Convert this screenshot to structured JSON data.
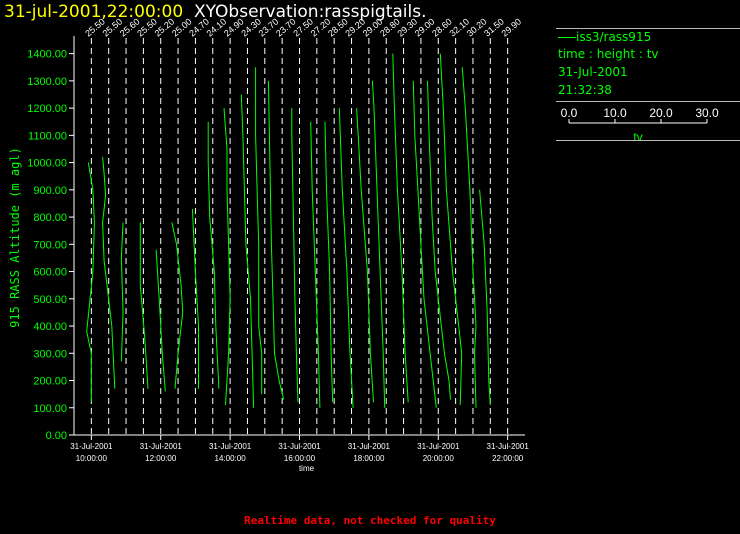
{
  "header": {
    "datetime": "31-jul-2001,22:00:00",
    "name": "XYObservation:rasspigtails."
  },
  "legend": {
    "series": "iss3/rass915",
    "line2": "time : height : tv",
    "date": "31-Jul-2001",
    "time": "21:32:38",
    "scale_ticks": [
      "0.0",
      "10.0",
      "20.0",
      "30.0"
    ],
    "scale_label": "tv"
  },
  "footer": "Realtime data, not checked for quality",
  "colors": {
    "background": "#000000",
    "trace": "#00ff00",
    "axis": "#ffffff",
    "datetime": "#ffff00",
    "footer": "#ff0000"
  },
  "chart_data": {
    "type": "line",
    "ylabel": "915 RASS Altitude (m agl)",
    "xlabel": "time",
    "ylim": [
      0,
      1450
    ],
    "yticks": [
      "0.00",
      "100.00",
      "200.00",
      "300.00",
      "400.00",
      "500.00",
      "600.00",
      "700.00",
      "800.00",
      "900.00",
      "1000.00",
      "1100.00",
      "1200.00",
      "1300.00",
      "1400.00"
    ],
    "xlim": [
      "31-Jul-2001 09:30",
      "31-Jul-2001 22:30"
    ],
    "xticks": [
      {
        "t": "31-Jul-2001 10:00",
        "date": "31-Jul-2001",
        "time": "10:00:00"
      },
      {
        "t": "31-Jul-2001 12:00",
        "date": "31-Jul-2001",
        "time": "12:00:00"
      },
      {
        "t": "31-Jul-2001 14:00",
        "date": "31-Jul-2001",
        "time": "14:00:00"
      },
      {
        "t": "31-Jul-2001 16:00",
        "date": "31-Jul-2001",
        "time": "16:00:00"
      },
      {
        "t": "31-Jul-2001 18:00",
        "date": "31-Jul-2001",
        "time": "18:00:00"
      },
      {
        "t": "31-Jul-2001 20:00",
        "date": "31-Jul-2001",
        "time": "20:00:00"
      },
      {
        "t": "31-Jul-2001 22:00",
        "date": "31-Jul-2001",
        "time": "22:00:00"
      }
    ],
    "tv_scale": [
      0,
      30
    ],
    "profiles": [
      {
        "time": "31-Jul-2001 10:00",
        "label": "25.50",
        "points": [
          [
            0.0,
            120
          ],
          [
            0.0,
            300
          ],
          [
            -1.5,
            380
          ],
          [
            0.5,
            600
          ],
          [
            1.0,
            780
          ],
          [
            0.5,
            900
          ],
          [
            -1.0,
            1000
          ]
        ]
      },
      {
        "time": "31-Jul-2001 10:30",
        "label": "25.50",
        "points": [
          [
            2.0,
            170
          ],
          [
            1.0,
            400
          ],
          [
            -1.5,
            640
          ],
          [
            -2.0,
            780
          ],
          [
            -1.0,
            880
          ],
          [
            -1.5,
            960
          ],
          [
            -2.0,
            1020
          ]
        ]
      },
      {
        "time": "31-Jul-2001 11:00",
        "label": "25.60",
        "points": [
          [
            -1.5,
            270
          ],
          [
            -1.0,
            450
          ],
          [
            -1.5,
            650
          ],
          [
            -1.0,
            780
          ]
        ]
      },
      {
        "time": "31-Jul-2001 11:30",
        "label": "25.50",
        "points": [
          [
            1.5,
            170
          ],
          [
            0.5,
            350
          ],
          [
            -1.0,
            550
          ],
          [
            -1.0,
            780
          ]
        ]
      },
      {
        "time": "31-Jul-2001 12:00",
        "label": "25.20",
        "points": [
          [
            1.5,
            160
          ],
          [
            0.5,
            300
          ],
          [
            -0.5,
            500
          ],
          [
            -1.5,
            680
          ]
        ]
      },
      {
        "time": "31-Jul-2001 12:30",
        "label": "25.00",
        "points": [
          [
            -1.0,
            170
          ],
          [
            0.0,
            300
          ],
          [
            1.5,
            450
          ],
          [
            1.0,
            550
          ],
          [
            -0.5,
            700
          ],
          [
            -2.0,
            780
          ]
        ]
      },
      {
        "time": "31-Jul-2001 13:00",
        "label": "24.70",
        "points": [
          [
            1.0,
            170
          ],
          [
            1.0,
            400
          ],
          [
            0.0,
            600
          ],
          [
            -1.0,
            830
          ]
        ]
      },
      {
        "time": "31-Jul-2001 13:30",
        "label": "24.10",
        "points": [
          [
            2.0,
            170
          ],
          [
            1.0,
            400
          ],
          [
            0.5,
            600
          ],
          [
            -1.0,
            800
          ],
          [
            -1.5,
            1000
          ],
          [
            -1.5,
            1150
          ]
        ]
      },
      {
        "time": "31-Jul-2001 14:00",
        "label": "24.90",
        "points": [
          [
            -1.5,
            110
          ],
          [
            -0.5,
            300
          ],
          [
            0.0,
            500
          ],
          [
            -0.5,
            700
          ],
          [
            -1.0,
            900
          ],
          [
            -1.0,
            1050
          ],
          [
            -2.0,
            1200
          ]
        ]
      },
      {
        "time": "31-Jul-2001 14:30",
        "label": "24.30",
        "points": [
          [
            2.0,
            100
          ],
          [
            1.5,
            300
          ],
          [
            1.0,
            500
          ],
          [
            -0.5,
            700
          ],
          [
            -1.0,
            900
          ],
          [
            -1.5,
            1100
          ],
          [
            -2.0,
            1250
          ]
        ]
      },
      {
        "time": "31-Jul-2001 15:00",
        "label": "23.70",
        "points": [
          [
            -1.0,
            150
          ],
          [
            -1.0,
            300
          ],
          [
            -2.0,
            400
          ],
          [
            -2.0,
            700
          ],
          [
            -2.5,
            900
          ],
          [
            -3.0,
            1100
          ],
          [
            -3.0,
            1350
          ]
        ]
      },
      {
        "time": "31-Jul-2001 15:30",
        "label": "23.70",
        "points": [
          [
            0.5,
            130
          ],
          [
            -1.0,
            200
          ],
          [
            -2.5,
            300
          ],
          [
            -3.0,
            500
          ],
          [
            -3.5,
            700
          ],
          [
            -4.0,
            1000
          ],
          [
            -4.5,
            1300
          ]
        ]
      },
      {
        "time": "31-Jul-2001 16:00",
        "label": "27.50",
        "points": [
          [
            -0.5,
            120
          ],
          [
            -1.0,
            300
          ],
          [
            -1.5,
            500
          ],
          [
            -2.0,
            800
          ],
          [
            -2.5,
            1100
          ],
          [
            -2.5,
            1200
          ]
        ]
      },
      {
        "time": "31-Jul-2001 16:30",
        "label": "27.20",
        "points": [
          [
            1.0,
            100
          ],
          [
            0.5,
            300
          ],
          [
            -0.5,
            600
          ],
          [
            -1.5,
            900
          ],
          [
            -2.0,
            1150
          ]
        ]
      },
      {
        "time": "31-Jul-2001 17:00",
        "label": "28.50",
        "points": [
          [
            -0.5,
            120
          ],
          [
            -1.0,
            300
          ],
          [
            -1.5,
            600
          ],
          [
            -2.5,
            900
          ],
          [
            -3.0,
            1150
          ]
        ]
      },
      {
        "time": "31-Jul-2001 17:30",
        "label": "29.20",
        "points": [
          [
            0.5,
            100
          ],
          [
            -0.5,
            300
          ],
          [
            -1.5,
            600
          ],
          [
            -3.0,
            900
          ],
          [
            -4.0,
            1200
          ]
        ]
      },
      {
        "time": "31-Jul-2001 18:00",
        "label": "29.00",
        "points": [
          [
            1.5,
            120
          ],
          [
            0.5,
            300
          ],
          [
            -0.5,
            600
          ],
          [
            -2.5,
            900
          ],
          [
            -3.5,
            1100
          ],
          [
            -4.0,
            1200
          ]
        ]
      },
      {
        "time": "31-Jul-2001 18:30",
        "label": "28.80",
        "points": [
          [
            -0.5,
            100
          ],
          [
            -1.0,
            300
          ],
          [
            -2.0,
            600
          ],
          [
            -3.0,
            900
          ],
          [
            -4.0,
            1200
          ],
          [
            -4.5,
            1300
          ]
        ]
      },
      {
        "time": "31-Jul-2001 19:00",
        "label": "29.30",
        "points": [
          [
            1.5,
            120
          ],
          [
            0.5,
            300
          ],
          [
            -0.5,
            600
          ],
          [
            -2.0,
            900
          ],
          [
            -3.0,
            1200
          ],
          [
            -3.5,
            1400
          ]
        ]
      },
      {
        "time": "31-Jul-2001 19:30",
        "label": "29.00",
        "points": [
          [
            5.0,
            100
          ],
          [
            3.0,
            300
          ],
          [
            1.0,
            500
          ],
          [
            0.0,
            700
          ],
          [
            -1.0,
            900
          ],
          [
            -2.0,
            1100
          ],
          [
            -2.5,
            1300
          ]
        ]
      },
      {
        "time": "31-Jul-2001 20:00",
        "label": "28.60",
        "points": [
          [
            4.0,
            130
          ],
          [
            3.5,
            200
          ],
          [
            2.0,
            300
          ],
          [
            0.5,
            450
          ],
          [
            -1.0,
            600
          ],
          [
            -2.0,
            800
          ],
          [
            -3.0,
            1100
          ],
          [
            -3.5,
            1300
          ]
        ]
      },
      {
        "time": "31-Jul-2001 20:30",
        "label": "32.10",
        "points": [
          [
            1.5,
            110
          ],
          [
            2.0,
            300
          ],
          [
            1.0,
            400
          ],
          [
            -1.0,
            600
          ],
          [
            -3.0,
            900
          ],
          [
            -4.0,
            1200
          ],
          [
            -5.0,
            1400
          ]
        ]
      },
      {
        "time": "31-Jul-2001 21:00",
        "label": "30.20",
        "points": [
          [
            1.0,
            100
          ],
          [
            0.5,
            300
          ],
          [
            1.0,
            400
          ],
          [
            0.0,
            600
          ],
          [
            -1.0,
            900
          ],
          [
            -2.5,
            1200
          ],
          [
            -3.5,
            1350
          ]
        ]
      },
      {
        "time": "31-Jul-2001 21:30",
        "label": "31.50",
        "points": [
          [
            0.0,
            110
          ],
          [
            -0.5,
            200
          ],
          [
            -1.0,
            450
          ],
          [
            -2.0,
            700
          ],
          [
            -3.5,
            900
          ]
        ]
      },
      {
        "time": "31-Jul-2001 22:00",
        "label": "29.90",
        "points": []
      }
    ]
  }
}
